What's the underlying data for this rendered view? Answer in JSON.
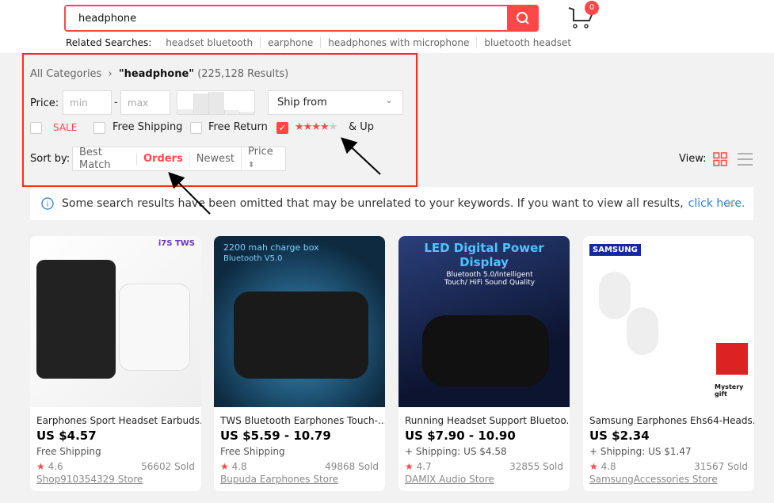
{
  "search": {
    "value": "headphone",
    "cart_count": "0"
  },
  "related": {
    "label": "Related Searches:",
    "items": [
      "headset bluetooth",
      "earphone",
      "headphones with microphone",
      "bluetooth headset"
    ]
  },
  "breadcrumb": {
    "root": "All Categories",
    "query": "\"headphone\"",
    "count": "(225,128 Results)"
  },
  "filters": {
    "price_label": "Price:",
    "min_placeholder": "min",
    "max_placeholder": "max",
    "dash": "-",
    "ship_from": "Ship from",
    "sale": "SALE",
    "free_shipping": "Free Shipping",
    "free_return": "Free Return",
    "rating_suffix": "& Up",
    "rating_stars": 4,
    "rating_checked": true
  },
  "sort": {
    "label": "Sort by:",
    "options": [
      "Best Match",
      "Orders",
      "Newest",
      "Price"
    ],
    "active": "Orders"
  },
  "view": {
    "label": "View:"
  },
  "notice": {
    "text": "Some search results have been omitted that may be unrelated to your keywords. If you want to view all results,",
    "link": "click here."
  },
  "accent": "#ff4747",
  "products": [
    {
      "title": "Earphones Sport Headset Earbuds...",
      "price": "US $4.57",
      "shipping": "Free Shipping",
      "rating": "4.6",
      "sold": "56602 Sold",
      "store": "Shop910354329 Store",
      "image_text": "i7S TWS"
    },
    {
      "title": "TWS Bluetooth Earphones Touch-...",
      "price": "US $5.59 - 10.79",
      "shipping": "Free Shipping",
      "rating": "4.8",
      "sold": "49868 Sold",
      "store": "Bupuda Earphones Store",
      "image_text": "2200 mah charge box",
      "image_text2": "Bluetooth V5.0"
    },
    {
      "title": "Running Headset Support Bluetoo...",
      "price": "US $7.90 - 10.90",
      "shipping": "+ Shipping: US $4.58",
      "rating": "4.7",
      "sold": "32855 Sold",
      "store": "DAMIX Audio Store",
      "image_text": "LED Digital Power Display",
      "image_text2": "Bluetooth 5.0/Intelligent Touch/ HiFi Sound Quality"
    },
    {
      "title": "Samsung Earphones Ehs64-Heads...",
      "price": "US $2.34",
      "shipping": "+ Shipping: US $1.47",
      "rating": "4.8",
      "sold": "31567 Sold",
      "store": "SamsungAccessories Store",
      "image_text": "SAMSUNG",
      "image_text2": "Mystery gift"
    }
  ]
}
